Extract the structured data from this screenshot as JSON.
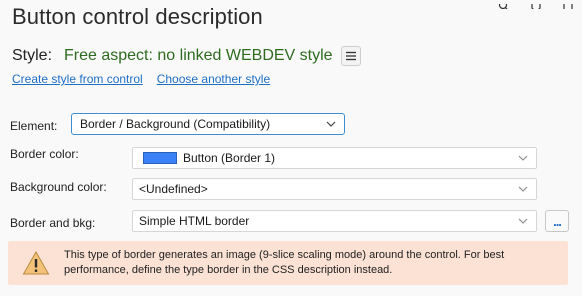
{
  "window": {
    "title": "Button control description"
  },
  "style": {
    "label": "Style:",
    "value": "Free aspect: no linked WEBDEV style",
    "create_link": "Create style from control",
    "choose_link": "Choose another style"
  },
  "fields": {
    "element_label": "Element:",
    "element_value": "Border / Background (Compatibility)",
    "border_color_label": "Border color:",
    "border_color_value": "Button (Border 1)",
    "border_color_swatch": "#3b82f6",
    "background_color_label": "Background color:",
    "background_color_value": "<Undefined>",
    "border_bkg_label": "Border and bkg:",
    "border_bkg_value": "Simple HTML border",
    "ellipsis_label": "..."
  },
  "warning": {
    "line1": "This type of border generates an image (9-slice scaling mode) around the control. For best",
    "line2": "performance, define the type border in the CSS description instead."
  },
  "colors": {
    "accent_link": "#1f6fc5",
    "style_value": "#2e6b1f",
    "warning_bg": "#fbe2d5"
  }
}
